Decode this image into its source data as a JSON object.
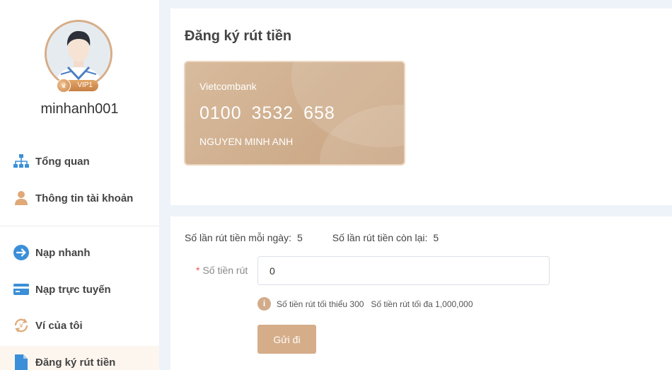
{
  "profile": {
    "username": "minhanh001",
    "vip_label": "VIP1"
  },
  "menu": {
    "items": [
      {
        "label": "Tổng quan",
        "icon": "sitemap-icon"
      },
      {
        "label": "Thông tin tài khoản",
        "icon": "user-icon"
      },
      {
        "label": "Nạp nhanh",
        "icon": "arrow-right-circle-icon"
      },
      {
        "label": "Nạp trực tuyến",
        "icon": "credit-card-icon"
      },
      {
        "label": "Ví của tôi",
        "icon": "exchange-icon"
      },
      {
        "label": "Đăng ký rút tiền",
        "icon": "document-icon",
        "active": true
      }
    ]
  },
  "page": {
    "title": "Đăng ký rút tiền"
  },
  "card": {
    "bank": "Vietcombank",
    "number": "0100 3532 658",
    "holder": "NGUYEN MINH ANH"
  },
  "form": {
    "daily_limit_label": "Số lần rút tiền mỗi ngày:",
    "daily_limit_value": "5",
    "remaining_label": "Số lần rút tiền còn lại:",
    "remaining_value": "5",
    "amount_label": "Số tiền rút",
    "amount_required_mark": "*",
    "amount_value": "0",
    "min_hint": "Số tiền rút tối thiểu 300",
    "max_hint": "Số tiền rút tối đa 1,000,000",
    "submit_label": "Gửi đi"
  },
  "colors": {
    "accent": "#d5ad89",
    "sidebar_icon_blue": "#3b8fd8",
    "active_bg": "#fdf6ef"
  }
}
